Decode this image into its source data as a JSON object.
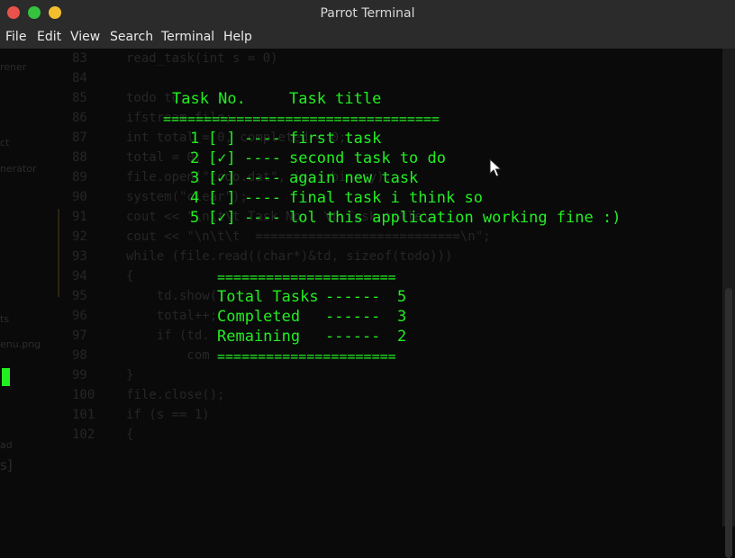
{
  "window": {
    "title": "Parrot Terminal"
  },
  "menubar": [
    "File",
    "Edit",
    "View",
    "Search",
    "Terminal",
    "Help"
  ],
  "background_editor": {
    "line_numbers": [
      "83",
      "84",
      "85",
      "86",
      "87",
      "88",
      "89",
      "90",
      "91",
      "92",
      "93",
      "94",
      "95",
      "96",
      "97",
      "98",
      "99",
      "100",
      "101",
      "102"
    ],
    "code": [
      "read_task(int s = 0)",
      "",
      "todo td;",
      "ifstream file;",
      "int total = 0, completed = 0;",
      "total = 0;",
      "file.open(\"todo.dat\", ios::binary);",
      "system(\"clear\");",
      "cout << \"\\n\\t\\t Task No.  \\t Task title\\n\";",
      "cout << \"\\n\\t\\t  ===========================\\n\";",
      "while (file.read((char*)&td, sizeof(todo)))",
      "{",
      "    td.show();",
      "    total++;",
      "    if (td.",
      "        com",
      "}",
      "file.close();",
      "if (s == 1)",
      "{"
    ]
  },
  "sidebar_fragments": [
    "rener",
    "ct",
    "nerator",
    "ts",
    "enu.png",
    "ad",
    "s]"
  ],
  "terminal": {
    "header_no": "Task No.",
    "header_title": "Task title",
    "header_rule": "==================================",
    "tasks": [
      {
        "num": "1",
        "check": "[ ]",
        "sep": "----",
        "title": "first task"
      },
      {
        "num": "2",
        "check": "[✓]",
        "sep": "----",
        "title": "second task to do"
      },
      {
        "num": "3",
        "check": "[✓]",
        "sep": "----",
        "title": "again new task"
      },
      {
        "num": "4",
        "check": "[ ]",
        "sep": "----",
        "title": "final task i think so"
      },
      {
        "num": "5",
        "check": "[✓]",
        "sep": "----",
        "title": "lol this application working fine :)"
      }
    ],
    "summary_rule": "======================",
    "summary": [
      {
        "label": "Total Tasks",
        "dashes": "------",
        "value": "5"
      },
      {
        "label": "Completed",
        "dashes": "------",
        "value": "3"
      },
      {
        "label": "Remaining",
        "dashes": "------",
        "value": "2"
      }
    ]
  },
  "colors": {
    "terminal_text": "#22ee22",
    "background": "#0a0a0a",
    "titlebar": "#2b2b2b"
  }
}
